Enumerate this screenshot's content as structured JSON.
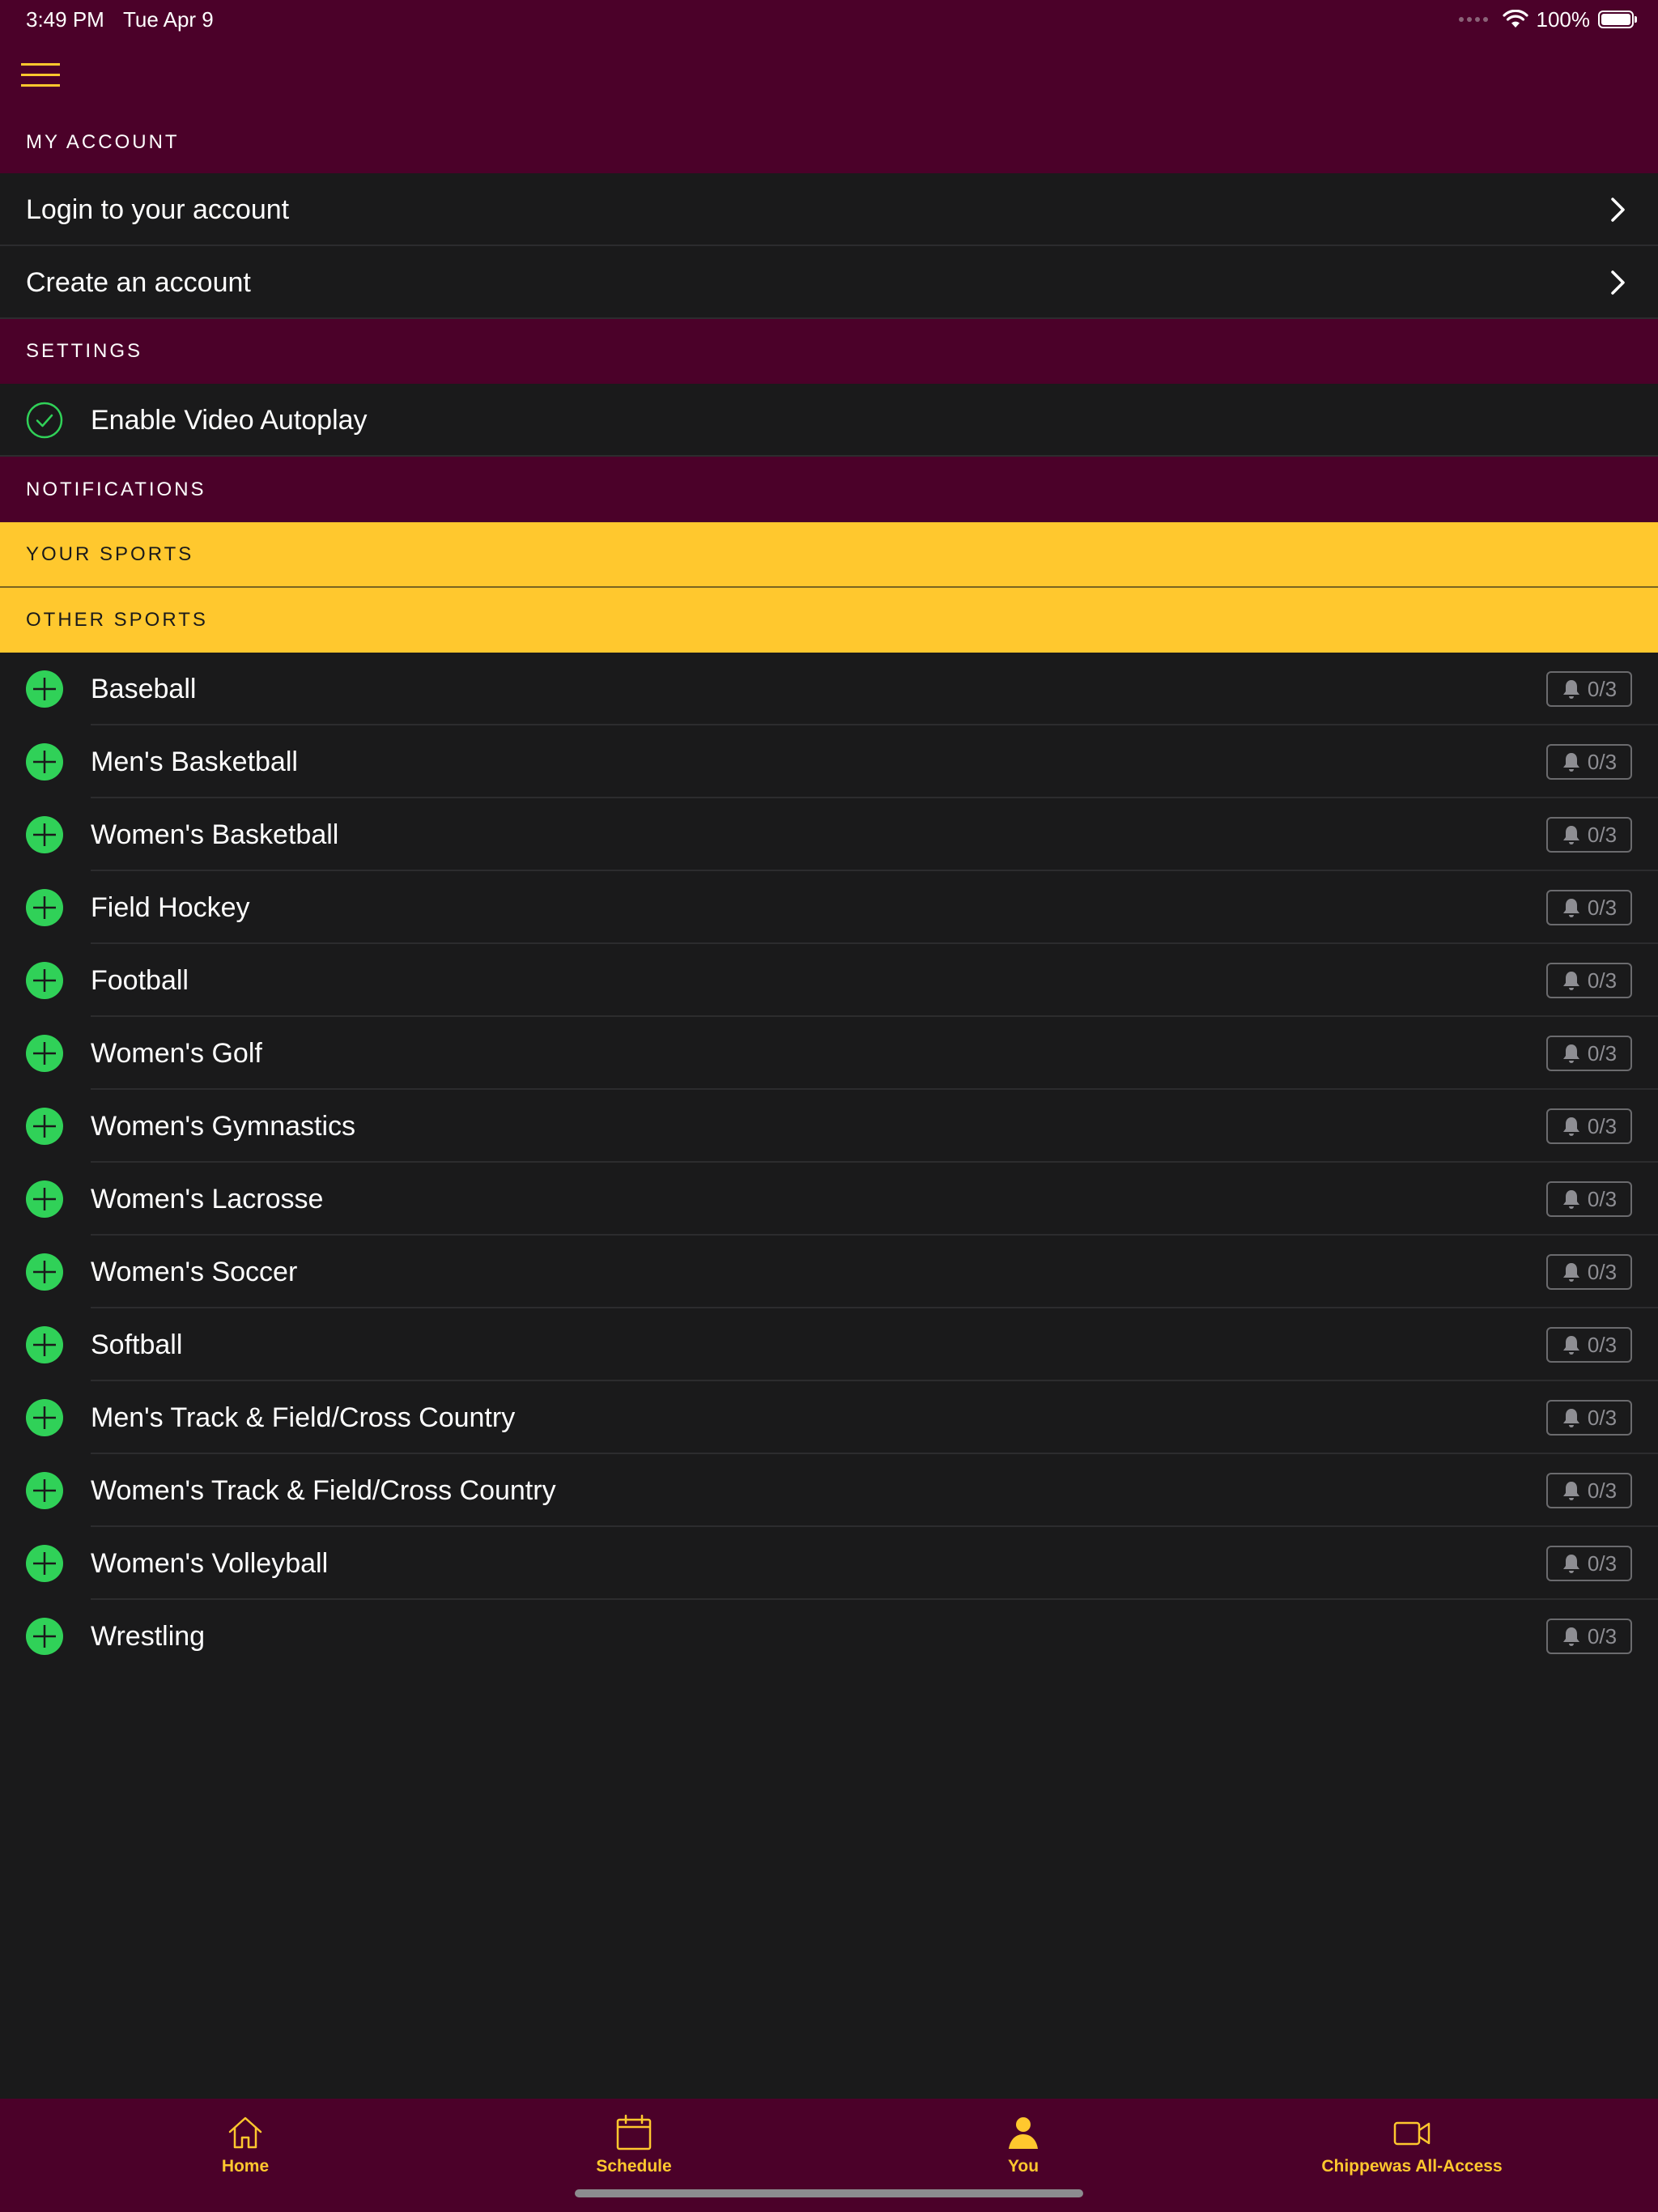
{
  "status_bar": {
    "time": "3:49 PM",
    "date": "Tue Apr 9",
    "battery": "100%"
  },
  "sections": {
    "my_account": "MY ACCOUNT",
    "settings": "SETTINGS",
    "notifications": "NOTIFICATIONS",
    "your_sports": "YOUR SPORTS",
    "other_sports": "OTHER SPORTS"
  },
  "account": {
    "login": "Login to your account",
    "create": "Create an account"
  },
  "settings_items": {
    "video_autoplay": "Enable Video Autoplay"
  },
  "sports": [
    {
      "name": "Baseball",
      "count": "0/3"
    },
    {
      "name": "Men's Basketball",
      "count": "0/3"
    },
    {
      "name": "Women's Basketball",
      "count": "0/3"
    },
    {
      "name": "Field Hockey",
      "count": "0/3"
    },
    {
      "name": "Football",
      "count": "0/3"
    },
    {
      "name": "Women's Golf",
      "count": "0/3"
    },
    {
      "name": "Women's Gymnastics",
      "count": "0/3"
    },
    {
      "name": "Women's Lacrosse",
      "count": "0/3"
    },
    {
      "name": "Women's Soccer",
      "count": "0/3"
    },
    {
      "name": "Softball",
      "count": "0/3"
    },
    {
      "name": "Men's Track & Field/Cross Country",
      "count": "0/3"
    },
    {
      "name": "Women's Track & Field/Cross Country",
      "count": "0/3"
    },
    {
      "name": "Women's Volleyball",
      "count": "0/3"
    },
    {
      "name": "Wrestling",
      "count": "0/3"
    }
  ],
  "tabs": [
    {
      "label": "Home",
      "icon": "home-icon"
    },
    {
      "label": "Schedule",
      "icon": "calendar-icon"
    },
    {
      "label": "You",
      "icon": "person-icon"
    },
    {
      "label": "Chippewas All-Access",
      "icon": "video-camera-icon"
    }
  ],
  "colors": {
    "maroon": "#4b0129",
    "gold": "#ffc82e",
    "row_bg": "#1a1a1b",
    "green": "#30d158",
    "badge_gray": "#8e8e93"
  }
}
